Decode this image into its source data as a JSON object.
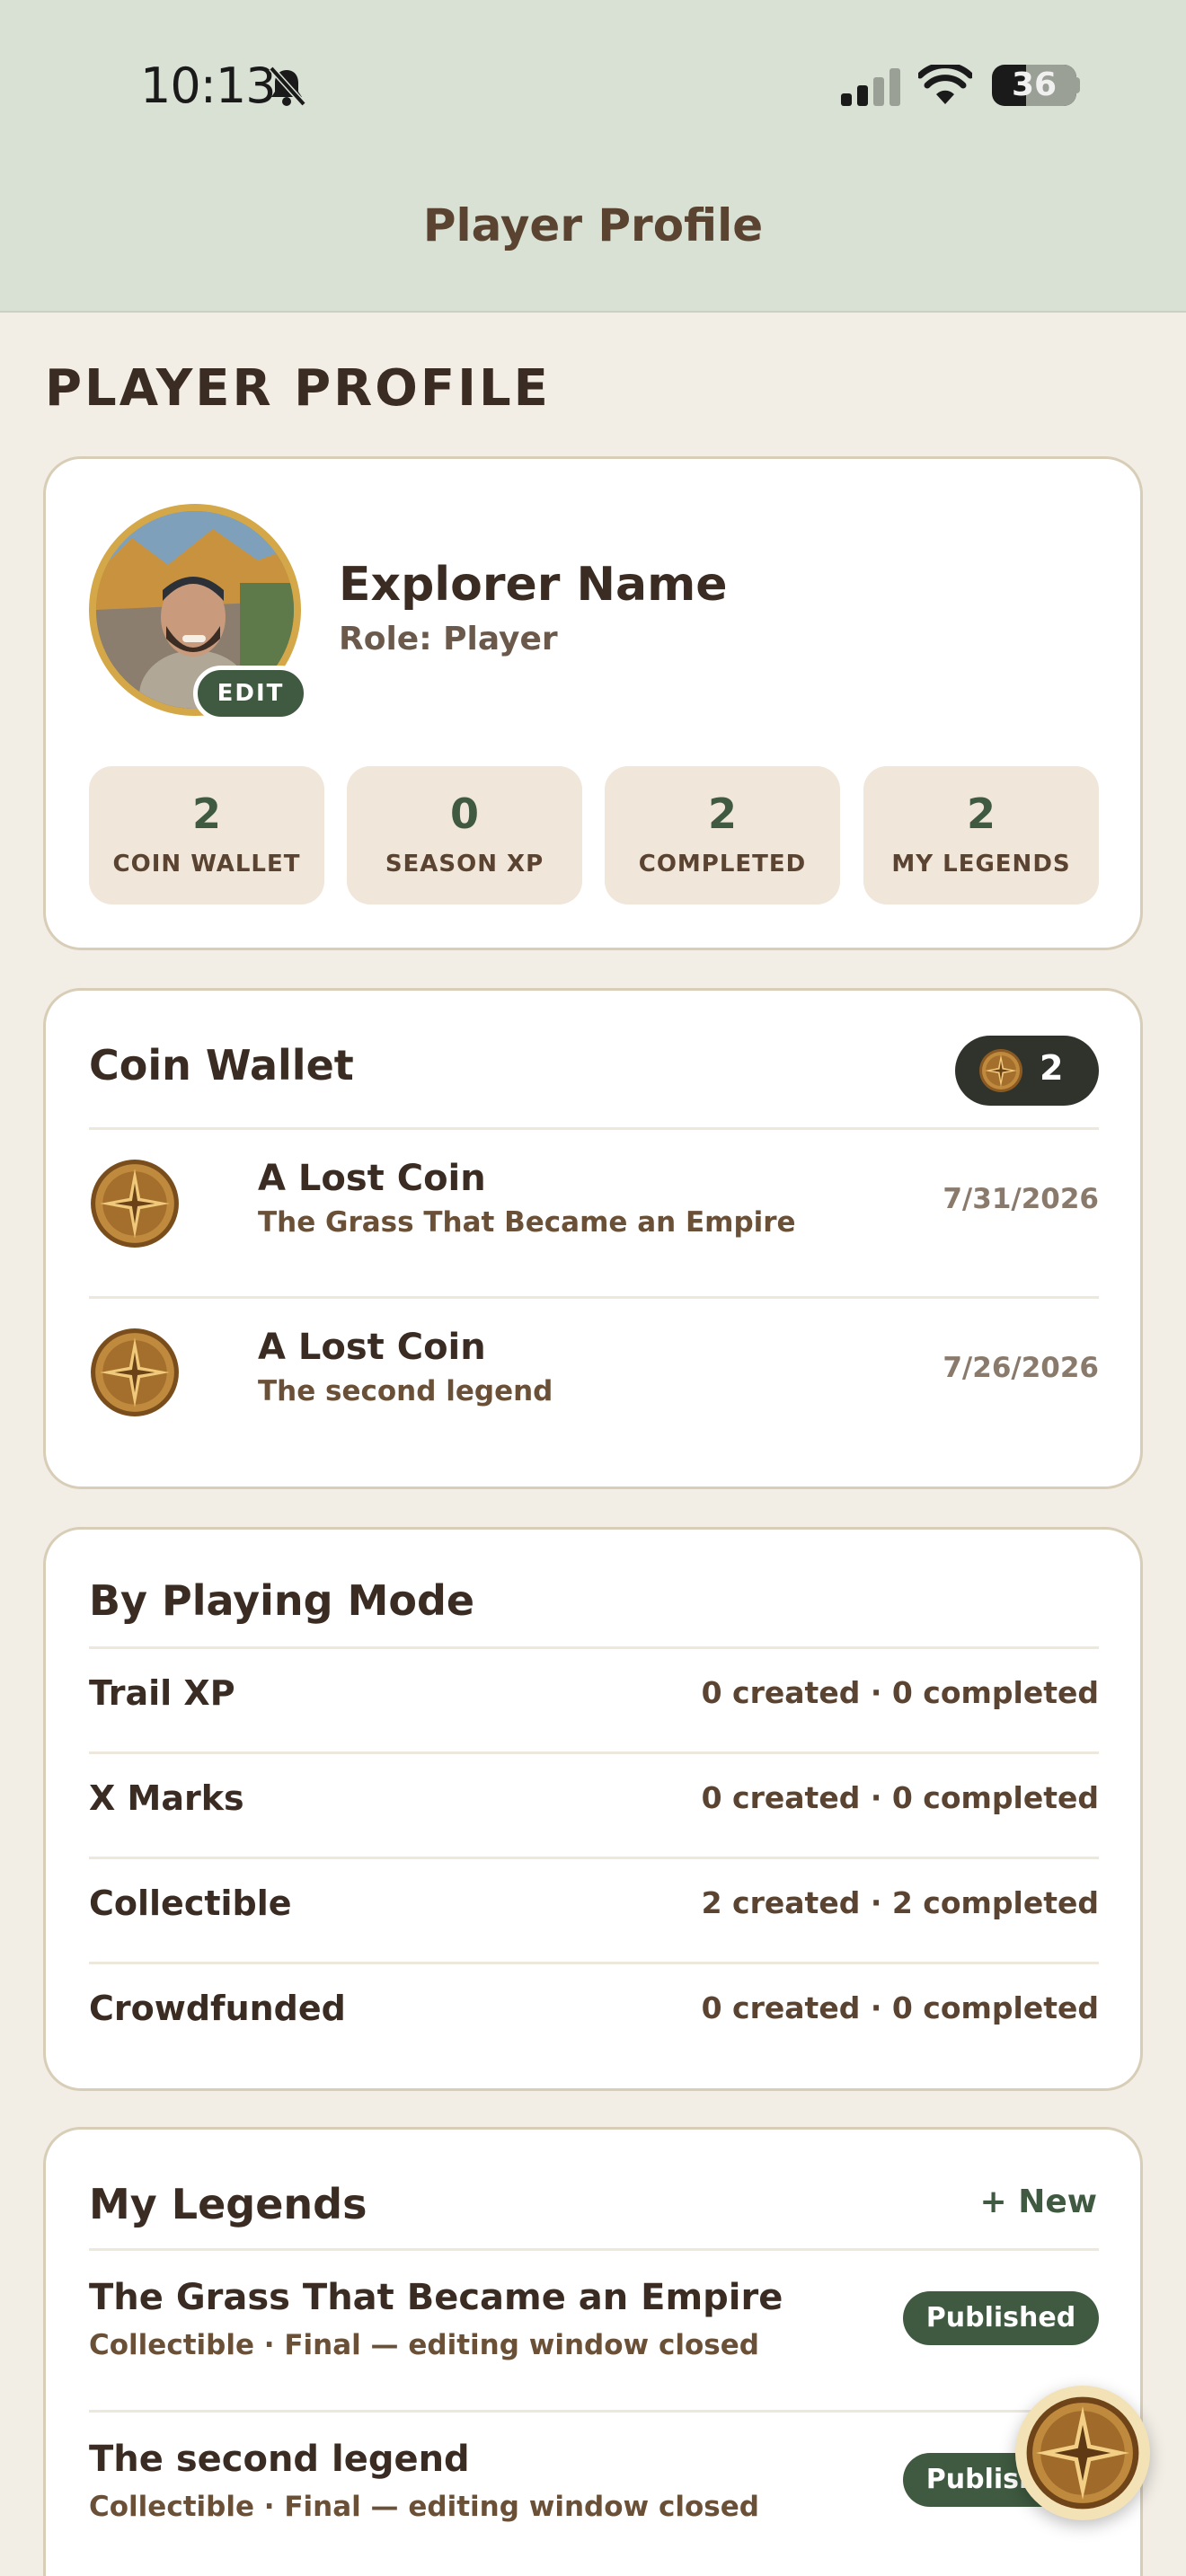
{
  "status_bar": {
    "time": "10:13",
    "battery": "36",
    "icons": [
      "bell-slash-icon",
      "signal-icon",
      "wifi-icon",
      "battery-icon"
    ]
  },
  "nav": {
    "title": "Player Profile"
  },
  "page": {
    "heading": "PLAYER PROFILE"
  },
  "profile": {
    "name": "Explorer Name",
    "role": "Role: Player",
    "edit_label": "EDIT",
    "stats": [
      {
        "value": "2",
        "label": "COIN WALLET"
      },
      {
        "value": "0",
        "label": "SEASON XP"
      },
      {
        "value": "2",
        "label": "COMPLETED"
      },
      {
        "value": "2",
        "label": "MY LEGENDS"
      }
    ]
  },
  "wallet": {
    "title": "Coin Wallet",
    "badge_count": "2",
    "items": [
      {
        "title": "A Lost Coin",
        "subtitle": "The Grass That Became an Empire",
        "date": "7/31/2026"
      },
      {
        "title": "A Lost Coin",
        "subtitle": "The second legend",
        "date": "7/26/2026"
      }
    ]
  },
  "modes": {
    "title": "By Playing Mode",
    "rows": [
      {
        "name": "Trail XP",
        "value": "0 created · 0 completed"
      },
      {
        "name": "X Marks",
        "value": "0 created · 0 completed"
      },
      {
        "name": "Collectible",
        "value": "2 created · 2 completed"
      },
      {
        "name": "Crowdfunded",
        "value": "0 created · 0 completed"
      }
    ]
  },
  "legends": {
    "title": "My Legends",
    "new_label": "+ New",
    "items": [
      {
        "title": "The Grass That Became an Empire",
        "subtitle": "Collectible · Final — editing window closed",
        "status": "Published"
      },
      {
        "title": "The second legend",
        "subtitle": "Collectible · Final — editing window closed",
        "status": "Published"
      }
    ]
  },
  "colors": {
    "header_bg": "#d8e1d4",
    "page_bg": "#f2eee6",
    "accent_green": "#3f5a40",
    "brown_text": "#5a4330",
    "coin_gold": "#b8863a"
  }
}
